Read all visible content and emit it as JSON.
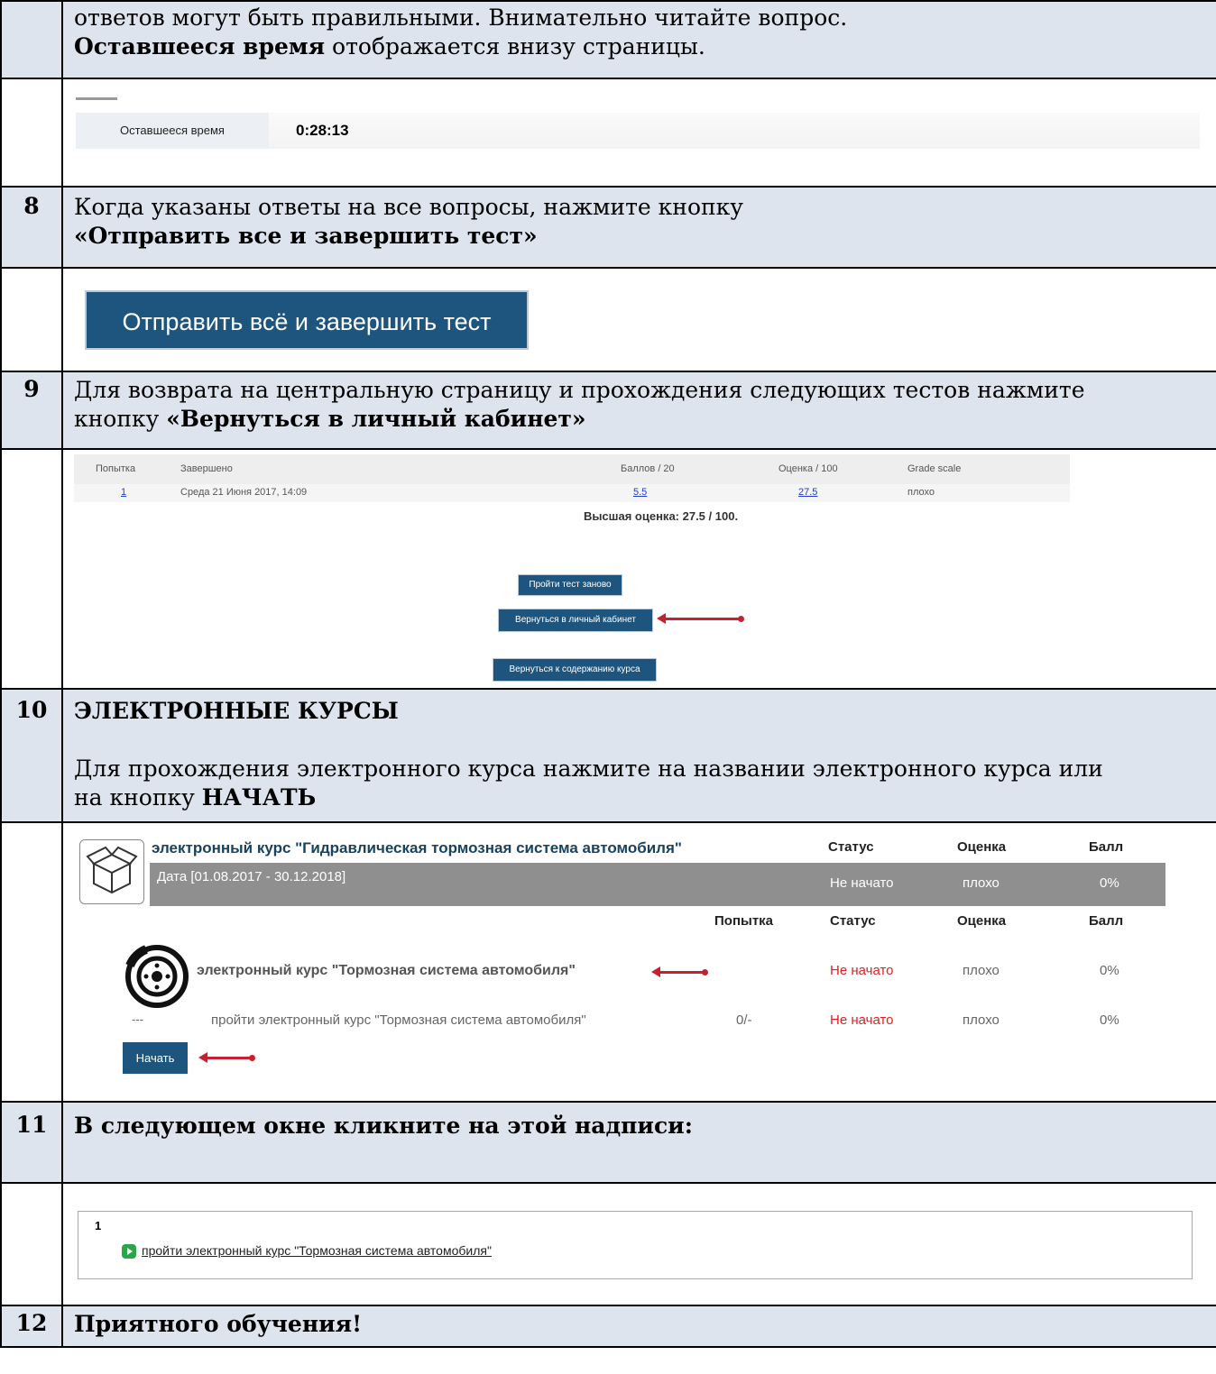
{
  "rows": {
    "intro": {
      "line1": "ответов могут быть правильными. Внимательно читайте вопрос.",
      "line2_bold": "Оставшееся время",
      "line2_rest": " отображается внизу страницы."
    },
    "timer": {
      "label": "Оставшееся время",
      "value": "0:28:13"
    },
    "step8": {
      "num": "8",
      "line1": "Когда указаны ответы на все вопросы, нажмите кнопку",
      "line2_bold": "«Отправить все и завершить тест»"
    },
    "finish_button": "Отправить всё и завершить тест",
    "step9": {
      "num": "9",
      "line1": "Для возврата на центральную страницу и прохождения следующих тестов нажмите",
      "line2_plain": "кнопку ",
      "line2_bold": "«Вернуться в личный кабинет»"
    },
    "attempts": {
      "headers": [
        "Попытка",
        "Завершено",
        "Баллов / 20",
        "Оценка / 100",
        "Grade scale"
      ],
      "row": {
        "attempt": "1",
        "finished": "Среда 21 Июня 2017, 14:09",
        "points": "5.5",
        "grade": "27.5",
        "scale": "плохо"
      },
      "best": "Высшая оценка: 27.5 / 100.",
      "retake_button": "Пройти тест заново",
      "cabinet_button": "Вернуться в личный кабинет",
      "course_button": "Вернуться к содержанию курса"
    },
    "step10": {
      "num": "10",
      "heading": "ЭЛЕКТРОННЫЕ КУРСЫ",
      "line1": "Для прохождения электронного курса нажмите на названии электронного курса или",
      "line2_plain": "на кнопку ",
      "line2_bold": "НАЧАТЬ"
    },
    "course": {
      "title": "электронный курс \"Гидравлическая тормозная система автомобиля\"",
      "headers": {
        "status": "Статус",
        "grade": "Оценка",
        "score": "Балл"
      },
      "date": "Дата [01.08.2017 - 30.12.2018]",
      "status": "Не начато",
      "grade": "плохо",
      "score": "0%",
      "sub_headers": {
        "attempt": "Попытка",
        "status": "Статус",
        "grade": "Оценка",
        "score": "Балл"
      },
      "module_title": "электронный курс \"Тормозная система автомобиля\"",
      "module_status": "Не начато",
      "module_grade": "плохо",
      "module_score": "0%",
      "item_dash": "---",
      "item_title": "пройти электронный курс \"Тормозная система автомобиля\"",
      "item_attempt": "0/-",
      "item_status": "Не начато",
      "item_grade": "плохо",
      "item_score": "0%",
      "start_button": "Начать"
    },
    "step11": {
      "num": "11",
      "text": "В следующем окне кликните на этой надписи:"
    },
    "lesson": {
      "num": "1",
      "link": "пройти электронный курс \"Тормозная система автомобиля\""
    },
    "step12": {
      "num": "12",
      "text": "Приятного обучения!"
    }
  },
  "colors": {
    "row_highlight": "#dde4ee",
    "button_blue": "#1d557f",
    "arrow_red": "#c8202e",
    "status_red": "#e02020"
  }
}
